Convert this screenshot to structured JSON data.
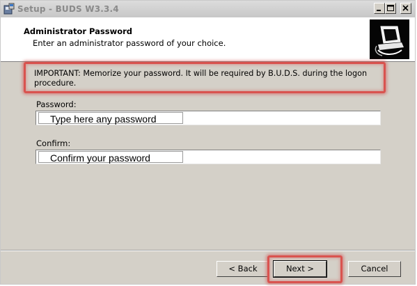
{
  "window": {
    "title": "Setup - BUDS W3.3.4",
    "controls": {
      "minimize": "_",
      "maximize": "□",
      "close": "×"
    }
  },
  "header": {
    "title": "Administrator Password",
    "subtitle": "Enter an administrator password of your choice."
  },
  "notice": {
    "text": "IMPORTANT: Memorize your password. It will be required by B.U.D.S. during the logon procedure."
  },
  "password": {
    "label": "Password:",
    "value": "Type here any password"
  },
  "confirm": {
    "label": "Confirm:",
    "value": "Confirm your password"
  },
  "buttons": {
    "back": "< Back",
    "next": "Next >",
    "cancel": "Cancel"
  },
  "colors": {
    "highlight": "#d9534f",
    "dialog_bg": "#d4d0c8"
  },
  "icons": {
    "app": "setup-icon",
    "header": "computer-icon"
  }
}
